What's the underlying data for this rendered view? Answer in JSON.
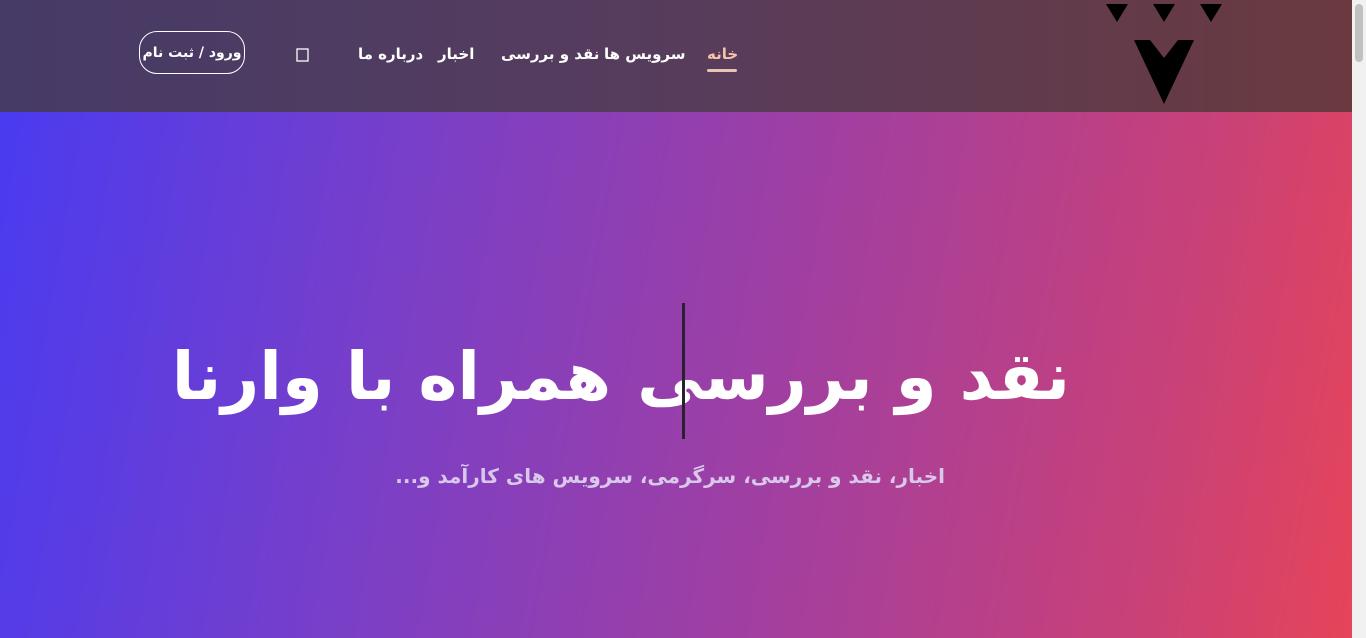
{
  "header": {
    "logo_icon": "varna-logo-icon",
    "nav": [
      {
        "label": "خانه",
        "active": true
      },
      {
        "label": "سرویس ها",
        "active": false
      },
      {
        "label": "نقد و بررسی",
        "active": false
      },
      {
        "label": "اخبار",
        "active": false
      },
      {
        "label": "درباره ما",
        "active": false
      }
    ],
    "search_icon": "search-icon",
    "login_label": "ورود / ثبت نام"
  },
  "hero": {
    "title_part_1": "نقد و بررسی",
    "title_part_2": "همراه با وارنا",
    "subtitle": "اخبار، نقد و بررسی، سرگرمی، سرویس های کارآمد و..."
  },
  "colors": {
    "header_gradient": [
      "#463b67",
      "#6a3a3f"
    ],
    "hero_gradient": [
      "#4a3bf0",
      "#e64459"
    ],
    "active_nav": "#f3c4a8"
  }
}
